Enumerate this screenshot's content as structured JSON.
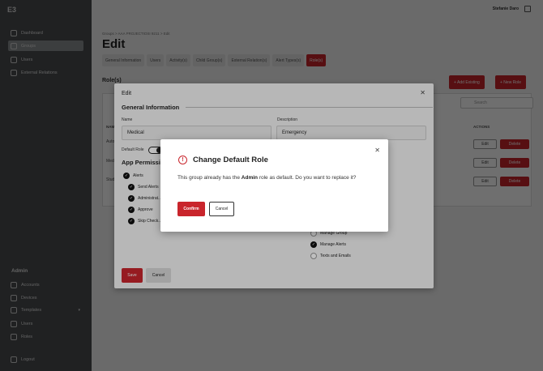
{
  "app": {
    "logo": "E3",
    "user_name": "Stefanie Daro"
  },
  "sidebar": {
    "items": [
      {
        "label": "Dashboard"
      },
      {
        "label": "Groups"
      },
      {
        "label": "Users"
      },
      {
        "label": "External Relations"
      }
    ],
    "admin_heading": "Admin",
    "admin_items": [
      {
        "label": "Accounts"
      },
      {
        "label": "Devices"
      },
      {
        "label": "Templates"
      },
      {
        "label": "Users"
      },
      {
        "label": "Roles"
      }
    ],
    "logout": "Logout"
  },
  "page": {
    "breadcrumb": "Groups  >  AAA PROJECTIOSI 9211  >  Edit",
    "title": "Edit",
    "tabs": [
      {
        "label": "General Information"
      },
      {
        "label": "Users"
      },
      {
        "label": "Activity(s)"
      },
      {
        "label": "Child Group(s)"
      },
      {
        "label": "External Relation(s)"
      },
      {
        "label": "Alert Types(s)"
      },
      {
        "label": "Role(s)"
      }
    ],
    "section": "Role(s)",
    "add_existing": "+ Add Existing",
    "new_role": "+ New Role",
    "search_placeholder": "Search",
    "col_name": "NAME",
    "col_actions": "ACTIONS",
    "rows": [
      {
        "name": "Auto..."
      },
      {
        "name": "Med..."
      },
      {
        "name": "Stud..."
      }
    ],
    "edit_label": "Edit",
    "delete_label": "Delete"
  },
  "edit_dialog": {
    "title": "Edit",
    "general_heading": "General Information",
    "name_label": "Name",
    "name_value": "Medical",
    "desc_label": "Description",
    "desc_value": "Emergency",
    "default_role_label": "Default Role",
    "permissions_heading": "App Permissions",
    "left_perms": [
      {
        "label": "Alerts",
        "checked": true
      },
      {
        "label": "Send Alerts",
        "checked": true
      },
      {
        "label": "Administrat...",
        "checked": true
      },
      {
        "label": "Approve",
        "checked": true
      },
      {
        "label": "Skip Check...",
        "checked": true
      }
    ],
    "right_perms": [
      {
        "label": "Manage Group",
        "checked": false
      },
      {
        "label": "Manage Alerts",
        "checked": true
      },
      {
        "label": "Texts and Emails",
        "checked": false
      }
    ],
    "save": "Save",
    "cancel": "Cancel"
  },
  "confirm_dialog": {
    "title": "Change Default Role",
    "body_pre": "This group already has the ",
    "body_role": "Admin",
    "body_post": " role as default. Do you want to replace it?",
    "confirm": "Confirm",
    "cancel": "Cancel"
  },
  "colors": {
    "accent": "#c9252c",
    "sidebar": "#4a4d50"
  }
}
